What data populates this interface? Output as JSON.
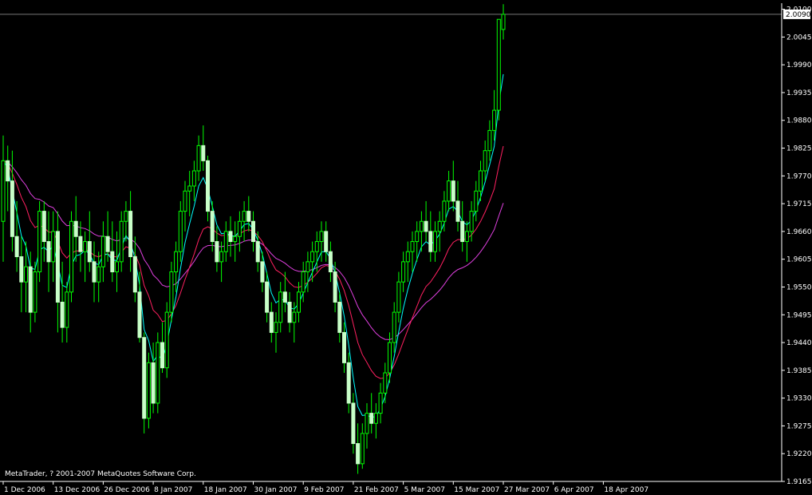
{
  "copyright": "MetaTrader, ? 2001-2007 MetaQuotes Software Corp.",
  "price_label": "2.0090",
  "colors": {
    "background": "#000000",
    "axis": "#ffffff",
    "candle_body": "#c8ffc8",
    "wick": "#00ff00",
    "ma_fast": "#00ffff",
    "ma_medium": "#ff2060",
    "ma_slow": "#e040e0"
  },
  "chart_data": {
    "type": "candlestick",
    "ylim": [
      1.9165,
      2.0112
    ],
    "x_tick_labels": [
      "1 Dec 2006",
      "13 Dec 2006",
      "26 Dec 2006",
      "8 Jan 2007",
      "18 Jan 2007",
      "30 Jan 2007",
      "9 Feb 2007",
      "21 Feb 2007",
      "5 Mar 2007",
      "15 Mar 2007",
      "27 Mar 2007",
      "6 Apr 2007",
      "18 Apr 2007"
    ],
    "x_tick_candles": [
      0,
      11,
      22,
      33,
      44,
      55,
      66,
      77,
      88,
      99,
      110,
      121,
      132
    ],
    "y_tick_labels": [
      "2.0100",
      "2.0045",
      "1.9990",
      "1.9935",
      "1.9880",
      "1.9825",
      "1.9770",
      "1.9715",
      "1.9660",
      "1.9605",
      "1.9550",
      "1.9495",
      "1.9440",
      "1.9385",
      "1.9330",
      "1.9275",
      "1.9220",
      "1.9165"
    ],
    "y_ticks": [
      2.01,
      2.0045,
      1.999,
      1.9935,
      1.988,
      1.9825,
      1.977,
      1.9715,
      1.966,
      1.9605,
      1.955,
      1.9495,
      1.944,
      1.9385,
      1.933,
      1.9275,
      1.922,
      1.9165
    ],
    "current_price": 2.009,
    "ohlc": [
      [
        1.968,
        1.985,
        1.96,
        1.98
      ],
      [
        1.98,
        1.983,
        1.97,
        1.976
      ],
      [
        1.976,
        1.982,
        1.962,
        1.965
      ],
      [
        1.965,
        1.972,
        1.958,
        1.961
      ],
      [
        1.961,
        1.965,
        1.95,
        1.956
      ],
      [
        1.956,
        1.964,
        1.95,
        1.959
      ],
      [
        1.959,
        1.962,
        1.946,
        1.95
      ],
      [
        1.95,
        1.96,
        1.948,
        1.958
      ],
      [
        1.958,
        1.972,
        1.956,
        1.97
      ],
      [
        1.97,
        1.972,
        1.96,
        1.964
      ],
      [
        1.964,
        1.97,
        1.954,
        1.96
      ],
      [
        1.96,
        1.97,
        1.956,
        1.966
      ],
      [
        1.966,
        1.97,
        1.946,
        1.952
      ],
      [
        1.952,
        1.96,
        1.944,
        1.947
      ],
      [
        1.947,
        1.956,
        1.944,
        1.954
      ],
      [
        1.954,
        1.97,
        1.952,
        1.968
      ],
      [
        1.968,
        1.973,
        1.96,
        1.965
      ],
      [
        1.965,
        1.968,
        1.958,
        1.962
      ],
      [
        1.962,
        1.966,
        1.956,
        1.964
      ],
      [
        1.964,
        1.97,
        1.958,
        1.96
      ],
      [
        1.96,
        1.964,
        1.952,
        1.956
      ],
      [
        1.956,
        1.962,
        1.952,
        1.959
      ],
      [
        1.959,
        1.968,
        1.956,
        1.965
      ],
      [
        1.965,
        1.97,
        1.96,
        1.962
      ],
      [
        1.962,
        1.968,
        1.956,
        1.958
      ],
      [
        1.958,
        1.966,
        1.954,
        1.96
      ],
      [
        1.96,
        1.97,
        1.958,
        1.968
      ],
      [
        1.968,
        1.972,
        1.964,
        1.97
      ],
      [
        1.97,
        1.974,
        1.958,
        1.961
      ],
      [
        1.961,
        1.965,
        1.952,
        1.954
      ],
      [
        1.954,
        1.958,
        1.944,
        1.945
      ],
      [
        1.945,
        1.946,
        1.926,
        1.929
      ],
      [
        1.929,
        1.942,
        1.927,
        1.94
      ],
      [
        1.94,
        1.944,
        1.93,
        1.932
      ],
      [
        1.932,
        1.946,
        1.93,
        1.944
      ],
      [
        1.944,
        1.948,
        1.938,
        1.939
      ],
      [
        1.939,
        1.952,
        1.937,
        1.95
      ],
      [
        1.95,
        1.96,
        1.948,
        1.958
      ],
      [
        1.958,
        1.964,
        1.954,
        1.962
      ],
      [
        1.962,
        1.972,
        1.96,
        1.97
      ],
      [
        1.97,
        1.976,
        1.966,
        1.974
      ],
      [
        1.974,
        1.978,
        1.969,
        1.975
      ],
      [
        1.975,
        1.98,
        1.972,
        1.978
      ],
      [
        1.978,
        1.985,
        1.976,
        1.983
      ],
      [
        1.983,
        1.987,
        1.978,
        1.98
      ],
      [
        1.98,
        1.981,
        1.968,
        1.97
      ],
      [
        1.97,
        1.972,
        1.962,
        1.964
      ],
      [
        1.964,
        1.967,
        1.958,
        1.96
      ],
      [
        1.96,
        1.964,
        1.956,
        1.962
      ],
      [
        1.962,
        1.968,
        1.96,
        1.966
      ],
      [
        1.966,
        1.969,
        1.961,
        1.964
      ],
      [
        1.964,
        1.968,
        1.96,
        1.965
      ],
      [
        1.965,
        1.97,
        1.962,
        1.968
      ],
      [
        1.968,
        1.972,
        1.964,
        1.97
      ],
      [
        1.97,
        1.973,
        1.966,
        1.968
      ],
      [
        1.968,
        1.97,
        1.962,
        1.964
      ],
      [
        1.964,
        1.966,
        1.958,
        1.96
      ],
      [
        1.96,
        1.962,
        1.954,
        1.956
      ],
      [
        1.956,
        1.958,
        1.948,
        1.95
      ],
      [
        1.95,
        1.952,
        1.944,
        1.946
      ],
      [
        1.946,
        1.95,
        1.942,
        1.948
      ],
      [
        1.948,
        1.956,
        1.946,
        1.954
      ],
      [
        1.954,
        1.958,
        1.95,
        1.952
      ],
      [
        1.952,
        1.954,
        1.946,
        1.948
      ],
      [
        1.948,
        1.952,
        1.944,
        1.95
      ],
      [
        1.95,
        1.956,
        1.948,
        1.954
      ],
      [
        1.954,
        1.96,
        1.952,
        1.958
      ],
      [
        1.958,
        1.962,
        1.954,
        1.96
      ],
      [
        1.96,
        1.964,
        1.956,
        1.962
      ],
      [
        1.962,
        1.966,
        1.958,
        1.964
      ],
      [
        1.964,
        1.968,
        1.96,
        1.966
      ],
      [
        1.966,
        1.968,
        1.96,
        1.962
      ],
      [
        1.962,
        1.964,
        1.956,
        1.958
      ],
      [
        1.958,
        1.96,
        1.95,
        1.952
      ],
      [
        1.952,
        1.954,
        1.944,
        1.946
      ],
      [
        1.946,
        1.948,
        1.938,
        1.94
      ],
      [
        1.94,
        1.942,
        1.93,
        1.932
      ],
      [
        1.932,
        1.934,
        1.922,
        1.924
      ],
      [
        1.924,
        1.928,
        1.918,
        1.92
      ],
      [
        1.92,
        1.928,
        1.919,
        1.926
      ],
      [
        1.926,
        1.932,
        1.923,
        1.93
      ],
      [
        1.93,
        1.934,
        1.926,
        1.928
      ],
      [
        1.928,
        1.932,
        1.925,
        1.93
      ],
      [
        1.93,
        1.936,
        1.928,
        1.934
      ],
      [
        1.934,
        1.94,
        1.932,
        1.938
      ],
      [
        1.938,
        1.946,
        1.936,
        1.944
      ],
      [
        1.944,
        1.952,
        1.942,
        1.95
      ],
      [
        1.95,
        1.958,
        1.948,
        1.956
      ],
      [
        1.956,
        1.962,
        1.954,
        1.96
      ],
      [
        1.96,
        1.964,
        1.956,
        1.962
      ],
      [
        1.962,
        1.966,
        1.958,
        1.964
      ],
      [
        1.964,
        1.968,
        1.96,
        1.966
      ],
      [
        1.966,
        1.97,
        1.962,
        1.968
      ],
      [
        1.968,
        1.972,
        1.964,
        1.966
      ],
      [
        1.966,
        1.97,
        1.96,
        1.962
      ],
      [
        1.962,
        1.968,
        1.96,
        1.966
      ],
      [
        1.966,
        1.97,
        1.962,
        1.968
      ],
      [
        1.968,
        1.974,
        1.966,
        1.972
      ],
      [
        1.972,
        1.978,
        1.97,
        1.976
      ],
      [
        1.976,
        1.98,
        1.97,
        1.972
      ],
      [
        1.972,
        1.976,
        1.966,
        1.968
      ],
      [
        1.968,
        1.972,
        1.962,
        1.964
      ],
      [
        1.964,
        1.968,
        1.96,
        1.966
      ],
      [
        1.966,
        1.972,
        1.964,
        1.97
      ],
      [
        1.97,
        1.976,
        1.968,
        1.974
      ],
      [
        1.974,
        1.98,
        1.972,
        1.978
      ],
      [
        1.978,
        1.984,
        1.976,
        1.982
      ],
      [
        1.982,
        1.988,
        1.98,
        1.986
      ],
      [
        1.986,
        1.994,
        1.984,
        1.99
      ],
      [
        1.99,
        2.004,
        1.988,
        2.008
      ],
      [
        2.006,
        2.011,
        2.004,
        2.009
      ]
    ]
  }
}
